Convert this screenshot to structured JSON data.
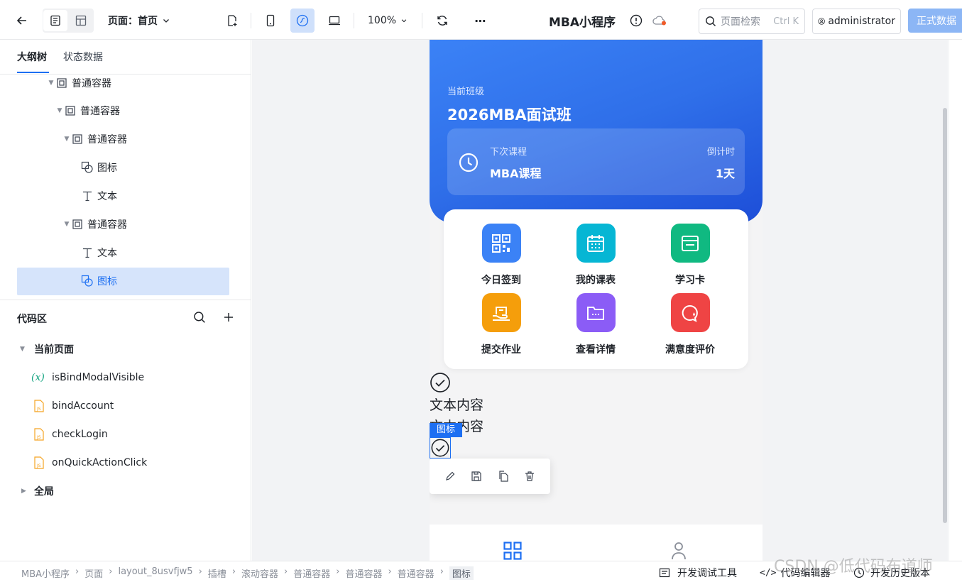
{
  "topbar": {
    "page_label": "页面：首页",
    "zoom": "100%",
    "app_title": "MBA小程序",
    "search_placeholder": "页面检索",
    "search_shortcut": "Ctrl K",
    "user": "administrator",
    "publish_button": "正式数据",
    "accent": "#1d6ff2"
  },
  "left": {
    "tabs": [
      "大纲树",
      "状态数据"
    ],
    "tree": [
      {
        "label": "普通容器",
        "icon": "container-icon"
      },
      {
        "label": "普通容器",
        "icon": "container-icon"
      },
      {
        "label": "普通容器",
        "icon": "container-icon"
      },
      {
        "label": "图标",
        "icon": "shape-icon"
      },
      {
        "label": "文本",
        "icon": "text-icon"
      },
      {
        "label": "普通容器",
        "icon": "container-icon"
      },
      {
        "label": "文本",
        "icon": "text-icon"
      },
      {
        "label": "图标",
        "icon": "shape-icon",
        "selected": true
      }
    ],
    "code_title": "代码区",
    "code_items": [
      {
        "label": "当前页面",
        "type": "group"
      },
      {
        "label": "isBindModalVisible",
        "type": "variable"
      },
      {
        "label": "bindAccount",
        "type": "js"
      },
      {
        "label": "checkLogin",
        "type": "js"
      },
      {
        "label": "onQuickActionClick",
        "type": "js"
      },
      {
        "label": "全局",
        "type": "group"
      }
    ]
  },
  "phone": {
    "class_caption": "当前班级",
    "class_name": "2026MBA面试班",
    "next_label": "下次课程",
    "next_course": "MBA课程",
    "countdown_label": "倒计时",
    "countdown_value": "1天",
    "actions": [
      {
        "label": "今日签到",
        "icon": "qrcode-icon",
        "color": "#3b82f6"
      },
      {
        "label": "我的课表",
        "icon": "calendar-icon",
        "color": "#06b6d4"
      },
      {
        "label": "学习卡",
        "icon": "card-icon",
        "color": "#10b981"
      },
      {
        "label": "提交作业",
        "icon": "hand-icon",
        "color": "#f59e0b"
      },
      {
        "label": "查看详情",
        "icon": "folder-icon",
        "color": "#8b5cf6"
      },
      {
        "label": "满意度评价",
        "icon": "feedback-icon",
        "color": "#ef4444"
      }
    ],
    "text1": "文本内容",
    "text2": "文本内容",
    "selection_tag": "图标"
  },
  "statusbar": {
    "crumbs": [
      "MBA小程序",
      "页面",
      "layout_8usvfjw5",
      "插槽",
      "滚动容器",
      "普通容器",
      "普通容器",
      "普通容器",
      "图标"
    ],
    "tools": [
      "开发调试工具",
      "代码编辑器",
      "开发历史版本"
    ]
  },
  "watermark": "CSDN @低代码布道师"
}
